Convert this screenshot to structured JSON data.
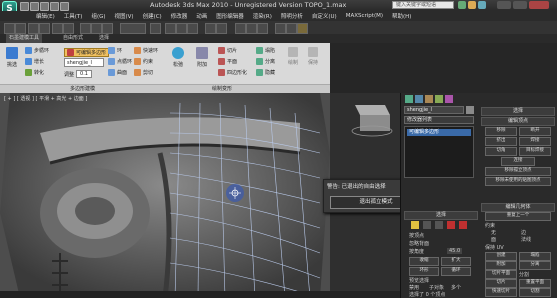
{
  "window": {
    "app_badge": "S",
    "title": "Autodesk 3ds Max  2010  - Unregistered Version    TOPO_1.max",
    "search_placeholder": "键入关键字或短语"
  },
  "menu": [
    "编辑(E)",
    "工具(T)",
    "组(G)",
    "视图(V)",
    "创建(C)",
    "修改器",
    "动画",
    "图形编辑器",
    "渲染(R)",
    "照明分析",
    "自定义(U)",
    "MAXScript(M)",
    "帮助(H)"
  ],
  "ribbon": {
    "tabs": [
      "石墨建模工具",
      "自由形式",
      "选择"
    ],
    "groups": {
      "polygon_modeling": "多边形建模",
      "modify_selection": "修改选择",
      "edit": "编辑",
      "geometry": "几何体(全部)",
      "loops": "循环",
      "subdivision": "细分"
    },
    "buttons": {
      "pick": "挑选",
      "step_loop": "步循环",
      "grow": "增长",
      "ring": "环",
      "shrink": "收缩",
      "convert": "转化",
      "editable_poly": "可编辑多边形",
      "surface": "曲面",
      "extend": "延伸",
      "dot_loop": "点循环",
      "swift_loop": "快速环",
      "relax": "松弛",
      "tessellate": "曲面",
      "cut": "剪切",
      "pattern": "平面",
      "subdivide": "细分",
      "constraints": "约束",
      "slice": "切片",
      "quadify": "四边形化",
      "hide": "隐藏",
      "paint": "绘制",
      "attach": "附加",
      "create": "创建",
      "collapse": "塌陷",
      "detach": "分离",
      "extrude": "挤出",
      "fillet": "倒角",
      "preserve": "保持"
    },
    "footer_left": "多边形建模",
    "footer_right": "绘制变形",
    "selection_value": "0.1",
    "selection_label": "调整"
  },
  "viewport": {
    "label": "[ + ] [ 透视 ] [ 平滑 + 高光 + 边面 ]"
  },
  "dialog": {
    "title": "警告: 已退出的自由选择",
    "button_label": "退出孤立模式"
  },
  "command_panel": {
    "object_name": "shengjie_l",
    "modifier_list": "修改器列表",
    "stack_item": "可编辑多边形",
    "rollouts": {
      "selection": "选择",
      "edit_vertices": "编辑顶点",
      "edit_geometry": "编辑几何体",
      "soft_selection": "软选择"
    },
    "edit_vertices_buttons": [
      "移除",
      "断开",
      "挤出",
      "焊接",
      "切角",
      "目标焊接",
      "连接",
      "移除孤立顶点",
      "移除未使用的贴图顶点"
    ],
    "edit_geometry_buttons": [
      "重复上一个",
      "约束",
      "无",
      "边",
      "面",
      "法线",
      "保持 UV",
      "创建",
      "塌陷",
      "附加",
      "分离",
      "切片平面",
      "分割",
      "切片",
      "重置平面",
      "快速切片",
      "切割",
      "网格平滑",
      "细化",
      "平面化",
      "X",
      "Y",
      "Z"
    ],
    "selection_checks": [
      "按顶点",
      "忽略背面",
      "按角度"
    ],
    "selection_angle": "45.0",
    "selection_buttons": [
      "收缩",
      "扩大",
      "环形",
      "循环"
    ],
    "preview_label": "预览选择",
    "preview_options": [
      "禁用",
      "子对象",
      "多个"
    ],
    "sub_object_count": "选择了 0 个顶点"
  }
}
